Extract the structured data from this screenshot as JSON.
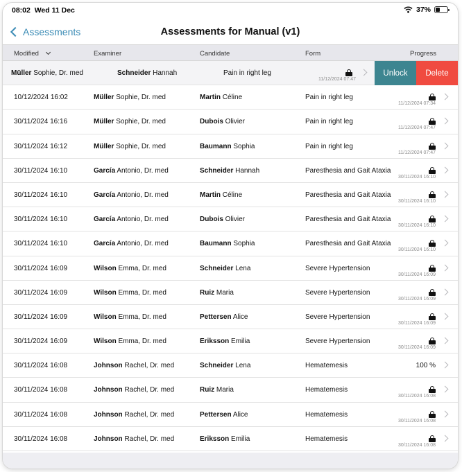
{
  "status": {
    "time": "08:02",
    "date": "Wed 11 Dec",
    "battery": "37%",
    "battery_level": 0.37
  },
  "nav": {
    "back_label": "Assessments",
    "title": "Assessments for Manual (v1)"
  },
  "columns": {
    "modified": "Modified",
    "examiner": "Examiner",
    "candidate": "Candidate",
    "form": "Form",
    "progress": "Progress"
  },
  "swipe": {
    "unlock": "Unlock",
    "delete": "Delete"
  },
  "rows": [
    {
      "modified": "",
      "examiner_last": "Müller",
      "examiner_first": "Sophie, Dr. med",
      "candidate_last": "Schneider",
      "candidate_first": "Hannah",
      "form": "Pain in right leg",
      "locked": true,
      "stamp": "11/12/2024 07:47",
      "progress": "",
      "swiped": true
    },
    {
      "modified": "10/12/2024 16:02",
      "examiner_last": "Müller",
      "examiner_first": "Sophie, Dr. med",
      "candidate_last": "Martin",
      "candidate_first": "Céline",
      "form": "Pain in right leg",
      "locked": true,
      "stamp": "11/12/2024 07:34",
      "progress": ""
    },
    {
      "modified": "30/11/2024 16:16",
      "examiner_last": "Müller",
      "examiner_first": "Sophie, Dr. med",
      "candidate_last": "Dubois",
      "candidate_first": "Olivier",
      "form": "Pain in right leg",
      "locked": true,
      "stamp": "11/12/2024 07:47",
      "progress": ""
    },
    {
      "modified": "30/11/2024 16:12",
      "examiner_last": "Müller",
      "examiner_first": "Sophie, Dr. med",
      "candidate_last": "Baumann",
      "candidate_first": "Sophia",
      "form": "Pain in right leg",
      "locked": true,
      "stamp": "11/12/2024 07:47",
      "progress": ""
    },
    {
      "modified": "30/11/2024 16:10",
      "examiner_last": "García",
      "examiner_first": "Antonio, Dr. med",
      "candidate_last": "Schneider",
      "candidate_first": "Hannah",
      "form": "Paresthesia and Gait Ataxia",
      "locked": true,
      "stamp": "30/11/2024 16:10",
      "progress": ""
    },
    {
      "modified": "30/11/2024 16:10",
      "examiner_last": "García",
      "examiner_first": "Antonio, Dr. med",
      "candidate_last": "Martin",
      "candidate_first": "Céline",
      "form": "Paresthesia and Gait Ataxia",
      "locked": true,
      "stamp": "30/11/2024 16:10",
      "progress": ""
    },
    {
      "modified": "30/11/2024 16:10",
      "examiner_last": "García",
      "examiner_first": "Antonio, Dr. med",
      "candidate_last": "Dubois",
      "candidate_first": "Olivier",
      "form": "Paresthesia and Gait Ataxia",
      "locked": true,
      "stamp": "30/11/2024 16:10",
      "progress": ""
    },
    {
      "modified": "30/11/2024 16:10",
      "examiner_last": "García",
      "examiner_first": "Antonio, Dr. med",
      "candidate_last": "Baumann",
      "candidate_first": "Sophia",
      "form": "Paresthesia and Gait Ataxia",
      "locked": true,
      "stamp": "30/11/2024 16:10",
      "progress": ""
    },
    {
      "modified": "30/11/2024 16:09",
      "examiner_last": "Wilson",
      "examiner_first": "Emma, Dr. med",
      "candidate_last": "Schneider",
      "candidate_first": "Lena",
      "form": "Severe Hypertension",
      "locked": true,
      "stamp": "30/11/2024 16:09",
      "progress": ""
    },
    {
      "modified": "30/11/2024 16:09",
      "examiner_last": "Wilson",
      "examiner_first": "Emma, Dr. med",
      "candidate_last": "Ruiz",
      "candidate_first": "Maria",
      "form": "Severe Hypertension",
      "locked": true,
      "stamp": "30/11/2024 16:09",
      "progress": ""
    },
    {
      "modified": "30/11/2024 16:09",
      "examiner_last": "Wilson",
      "examiner_first": "Emma, Dr. med",
      "candidate_last": "Pettersen",
      "candidate_first": "Alice",
      "form": "Severe Hypertension",
      "locked": true,
      "stamp": "30/11/2024 16:09",
      "progress": ""
    },
    {
      "modified": "30/11/2024 16:09",
      "examiner_last": "Wilson",
      "examiner_first": "Emma, Dr. med",
      "candidate_last": "Eriksson",
      "candidate_first": "Emilia",
      "form": "Severe Hypertension",
      "locked": true,
      "stamp": "30/11/2024 16:09",
      "progress": ""
    },
    {
      "modified": "30/11/2024 16:08",
      "examiner_last": "Johnson",
      "examiner_first": "Rachel, Dr. med",
      "candidate_last": "Schneider",
      "candidate_first": "Lena",
      "form": "Hematemesis",
      "locked": false,
      "stamp": "",
      "progress": "100 %"
    },
    {
      "modified": "30/11/2024 16:08",
      "examiner_last": "Johnson",
      "examiner_first": "Rachel, Dr. med",
      "candidate_last": "Ruiz",
      "candidate_first": "Maria",
      "form": "Hematemesis",
      "locked": true,
      "stamp": "30/11/2024 16:08",
      "progress": ""
    },
    {
      "modified": "30/11/2024 16:08",
      "examiner_last": "Johnson",
      "examiner_first": "Rachel, Dr. med",
      "candidate_last": "Pettersen",
      "candidate_first": "Alice",
      "form": "Hematemesis",
      "locked": true,
      "stamp": "30/11/2024 16:08",
      "progress": ""
    },
    {
      "modified": "30/11/2024 16:08",
      "examiner_last": "Johnson",
      "examiner_first": "Rachel, Dr. med",
      "candidate_last": "Eriksson",
      "candidate_first": "Emilia",
      "form": "Hematemesis",
      "locked": true,
      "stamp": "30/11/2024 16:08",
      "progress": ""
    }
  ]
}
